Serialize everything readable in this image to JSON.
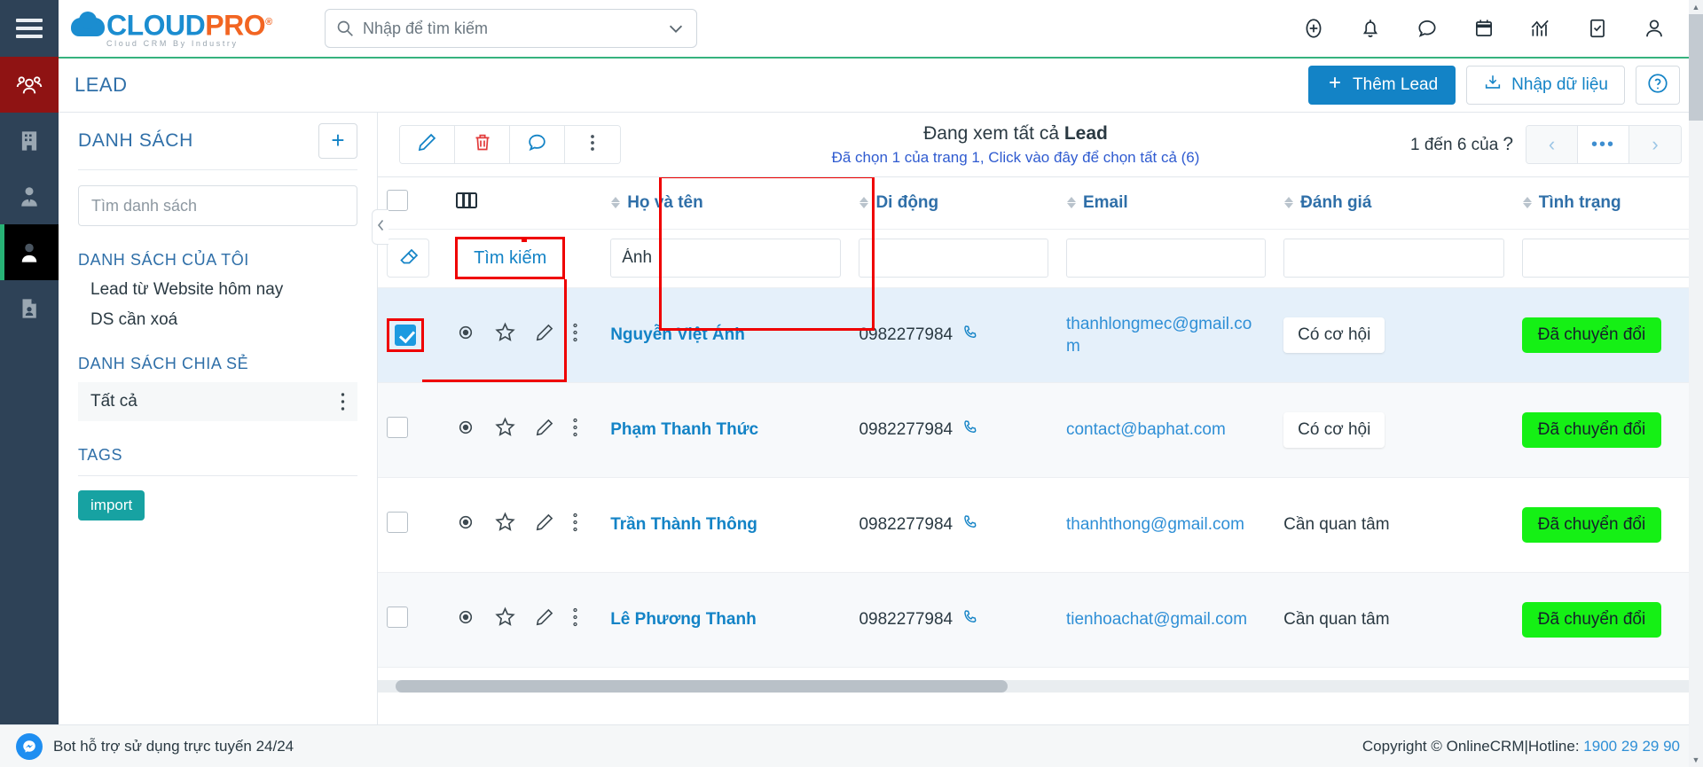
{
  "topbar": {
    "menu_icon": "hamburger-icon",
    "logo": {
      "part1": "CLOUD",
      "part2": "PRO",
      "registered": "®",
      "tagline": "Cloud CRM By Industry"
    },
    "search": {
      "placeholder": "Nhập để tìm kiếm",
      "value": "",
      "icon": "search-icon",
      "caret": "chevron-down-icon"
    },
    "icons": [
      "plus-circle-icon",
      "bell-icon",
      "chat-bubble-icon",
      "calendar-icon",
      "analytics-icon",
      "task-check-icon",
      "user-icon"
    ]
  },
  "rail": {
    "items": [
      {
        "name": "leads",
        "icon": "group-people-icon",
        "state": "active-red"
      },
      {
        "name": "companies",
        "icon": "building-icon",
        "state": "normal"
      },
      {
        "name": "contacts",
        "icon": "person-tie-icon",
        "state": "normal"
      },
      {
        "name": "customers",
        "icon": "person-icon",
        "state": "active-dark"
      },
      {
        "name": "documents",
        "icon": "document-person-icon",
        "state": "normal"
      }
    ]
  },
  "pageheader": {
    "title": "LEAD",
    "add_button": "Thêm Lead",
    "add_icon": "plus-icon",
    "import_button": "Nhập dữ liệu",
    "import_icon": "download-tray-icon",
    "help_icon": "question-circle-icon"
  },
  "leftpanel": {
    "title": "DANH SÁCH",
    "add_icon": "plus-icon",
    "search_placeholder": "Tìm danh sách",
    "search_value": "",
    "section_my": "DANH SÁCH CỦA TÔI",
    "my_items": [
      "Lead từ Website hôm nay",
      "DS cần xoá"
    ],
    "section_shared": "DANH SÁCH CHIA SẺ",
    "shared_item": "Tất cả",
    "shared_kebab_icon": "kebab-menu-icon",
    "section_tags": "TAGS",
    "tags": [
      "import"
    ],
    "collapse_icon": "chevron-left-icon"
  },
  "toolbar": {
    "buttons": [
      {
        "name": "edit",
        "icon": "pencil-icon",
        "color": "#1383c6"
      },
      {
        "name": "delete",
        "icon": "trash-icon",
        "color": "#e23b3b"
      },
      {
        "name": "comment",
        "icon": "chat-bubble-icon",
        "color": "#1383c6"
      },
      {
        "name": "more",
        "icon": "kebab-menu-icon",
        "color": "#4a5660"
      }
    ],
    "viewing_prefix": "Đang xem tất cả ",
    "viewing_entity": "Lead",
    "selection_note": "Đã chọn 1 của trang 1, Click vào đây để chọn tất cả (6)",
    "range_text": "1 đến 6 của",
    "range_unknown": "?",
    "pager": {
      "prev": "‹",
      "dots": "•••",
      "next": "›"
    }
  },
  "table": {
    "header_checkbox": false,
    "layout_icon": "column-layout-icon",
    "columns": [
      {
        "key": "name",
        "label": "Họ và tên",
        "sortable": true
      },
      {
        "key": "mobile",
        "label": "Di động",
        "sortable": true
      },
      {
        "key": "email",
        "label": "Email",
        "sortable": true
      },
      {
        "key": "rating",
        "label": "Đánh giá",
        "sortable": true
      },
      {
        "key": "status",
        "label": "Tình trạng",
        "sortable": true
      }
    ],
    "filterrow": {
      "erase_icon": "eraser-icon",
      "search_label": "Tìm kiếm",
      "name_value": "Ánh",
      "mobile_value": "",
      "email_value": "",
      "rating_value": "",
      "status_value": ""
    },
    "row_icons": [
      "eye-icon",
      "star-icon",
      "pencil-icon",
      "kebab-menu-icon"
    ],
    "phone_icon": "phone-icon",
    "rows": [
      {
        "selected": true,
        "name": "Nguyễn Việt Ánh",
        "mobile": "0982277984",
        "email": "thanhlongmec@gmail.com",
        "rating": "Có cơ hội",
        "rating_boxed": true,
        "status": "Đã chuyển đổi"
      },
      {
        "selected": false,
        "name": "Phạm Thanh Thức",
        "mobile": "0982277984",
        "email": "contact@baphat.com",
        "rating": "Có cơ hội",
        "rating_boxed": true,
        "status": "Đã chuyển đổi"
      },
      {
        "selected": false,
        "name": "Trần Thành Thông",
        "mobile": "0982277984",
        "email": "thanhthong@gmail.com",
        "rating": "Cần quan tâm",
        "rating_boxed": false,
        "status": "Đã chuyển đổi"
      },
      {
        "selected": false,
        "name": "Lê Phương Thanh",
        "mobile": "0982277984",
        "email": "tienhoachat@gmail.com",
        "rating": "Cần quan tâm",
        "rating_boxed": false,
        "status": "Đã chuyển đổi"
      }
    ]
  },
  "footer": {
    "bot_text": "Bot hỗ trợ sử dụng trực tuyến 24/24",
    "bot_icon": "messenger-icon",
    "copyright": "Copyright © OnlineCRM",
    "separator": "|",
    "hotline_label": "Hotline:",
    "hotline_number": "1900 29 29 90"
  },
  "colors": {
    "brand_blue": "#1383c6",
    "brand_orange": "#f26522",
    "rail_bg": "#2e4257",
    "active_red": "#8f1313",
    "accent_green": "#36b37e",
    "status_green": "#15f015",
    "annotation_red": "#ef0000",
    "tag_teal": "#17a2a2"
  }
}
